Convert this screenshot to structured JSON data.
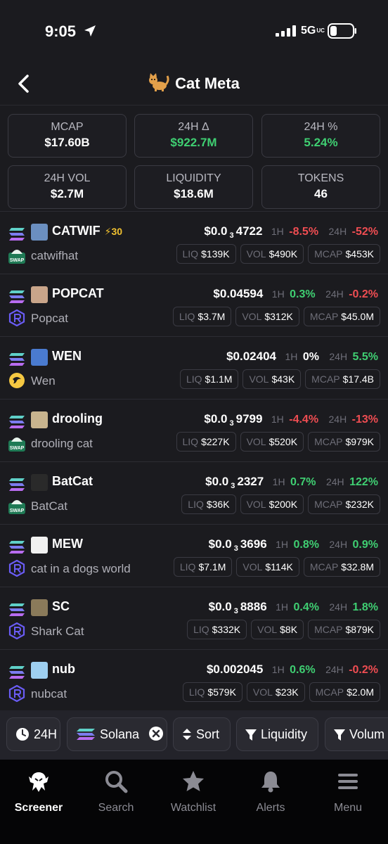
{
  "status": {
    "time": "9:05",
    "network": "5G",
    "network_sup": "UC"
  },
  "header": {
    "title": "Cat Meta"
  },
  "stats": [
    {
      "label": "MCAP",
      "value": "$17.60B",
      "tone": "white"
    },
    {
      "label": "24H Δ",
      "value": "$922.7M",
      "tone": "green"
    },
    {
      "label": "24H %",
      "value": "5.24%",
      "tone": "green"
    },
    {
      "label": "24H VOL",
      "value": "$2.7M",
      "tone": "white"
    },
    {
      "label": "LIQUIDITY",
      "value": "$18.6M",
      "tone": "white"
    },
    {
      "label": "TOKENS",
      "value": "46",
      "tone": "white"
    }
  ],
  "labels": {
    "h1": "1H",
    "h24": "24H",
    "liq": "LIQ",
    "vol": "VOL",
    "mcap": "MCAP"
  },
  "tokens": [
    {
      "symbol": "CATWIF",
      "boost": "⚡30",
      "name": "catwifhat",
      "dex": "swap-icon",
      "price_pre": "$0.0",
      "price_zeros": "3",
      "price_post": "4722",
      "h1": "-8.5%",
      "h1_tone": "red",
      "h24": "-52%",
      "h24_tone": "red",
      "liq": "$139K",
      "vol": "$490K",
      "mcap": "$453K",
      "avatar_color": "#6b8fc0"
    },
    {
      "symbol": "POPCAT",
      "boost": "",
      "name": "Popcat",
      "dex": "raydium-icon",
      "price_pre": "$0.04594",
      "price_zeros": "",
      "price_post": "",
      "h1": "0.3%",
      "h1_tone": "green",
      "h24": "-0.2%",
      "h24_tone": "red",
      "liq": "$3.7M",
      "vol": "$312K",
      "mcap": "$45.0M",
      "avatar_color": "#c9a58a"
    },
    {
      "symbol": "WEN",
      "boost": "",
      "name": "Wen",
      "dex": "orca-icon",
      "price_pre": "$0.02404",
      "price_zeros": "",
      "price_post": "",
      "h1": "0%",
      "h1_tone": "white",
      "h24": "5.5%",
      "h24_tone": "green",
      "liq": "$1.1M",
      "vol": "$43K",
      "mcap": "$17.4B",
      "avatar_color": "#4a7bd0"
    },
    {
      "symbol": "drooling",
      "boost": "",
      "name": "drooling cat",
      "dex": "swap-icon",
      "price_pre": "$0.0",
      "price_zeros": "3",
      "price_post": "9799",
      "h1": "-4.4%",
      "h1_tone": "red",
      "h24": "-13%",
      "h24_tone": "red",
      "liq": "$227K",
      "vol": "$520K",
      "mcap": "$979K",
      "avatar_color": "#c8b48e"
    },
    {
      "symbol": "BatCat",
      "boost": "",
      "name": "BatCat",
      "dex": "swap-icon",
      "price_pre": "$0.0",
      "price_zeros": "3",
      "price_post": "2327",
      "h1": "0.7%",
      "h1_tone": "green",
      "h24": "122%",
      "h24_tone": "green",
      "liq": "$36K",
      "vol": "$200K",
      "mcap": "$232K",
      "avatar_color": "#2a2a2a"
    },
    {
      "symbol": "MEW",
      "boost": "",
      "name": "cat in a dogs world",
      "dex": "raydium-icon",
      "price_pre": "$0.0",
      "price_zeros": "3",
      "price_post": "3696",
      "h1": "0.8%",
      "h1_tone": "green",
      "h24": "0.9%",
      "h24_tone": "green",
      "liq": "$7.1M",
      "vol": "$114K",
      "mcap": "$32.8M",
      "avatar_color": "#f1f1f1"
    },
    {
      "symbol": "SC",
      "boost": "",
      "name": "Shark Cat",
      "dex": "raydium-icon",
      "price_pre": "$0.0",
      "price_zeros": "3",
      "price_post": "8886",
      "h1": "0.4%",
      "h1_tone": "green",
      "h24": "1.8%",
      "h24_tone": "green",
      "liq": "$332K",
      "vol": "$8K",
      "mcap": "$879K",
      "avatar_color": "#8a7a5a"
    },
    {
      "symbol": "nub",
      "boost": "",
      "name": "nubcat",
      "dex": "raydium-icon",
      "price_pre": "$0.002045",
      "price_zeros": "",
      "price_post": "",
      "h1": "0.6%",
      "h1_tone": "green",
      "h24": "-0.2%",
      "h24_tone": "red",
      "liq": "$579K",
      "vol": "$23K",
      "mcap": "$2.0M",
      "avatar_color": "#9ecff0"
    }
  ],
  "filters": {
    "timeframe": "24H",
    "chain": "Solana",
    "sort": "Sort",
    "liquidity": "Liquidity",
    "volume": "Volum"
  },
  "nav": [
    {
      "label": "Screener",
      "icon": "eagle-icon",
      "active": true
    },
    {
      "label": "Search",
      "icon": "search-icon",
      "active": false
    },
    {
      "label": "Watchlist",
      "icon": "star-icon",
      "active": false
    },
    {
      "label": "Alerts",
      "icon": "bell-icon",
      "active": false
    },
    {
      "label": "Menu",
      "icon": "menu-icon",
      "active": false
    }
  ],
  "colors": {
    "background": "#1b1b1f",
    "green": "#3fcf72",
    "red": "#ef4d52",
    "boost": "#f2c230"
  }
}
